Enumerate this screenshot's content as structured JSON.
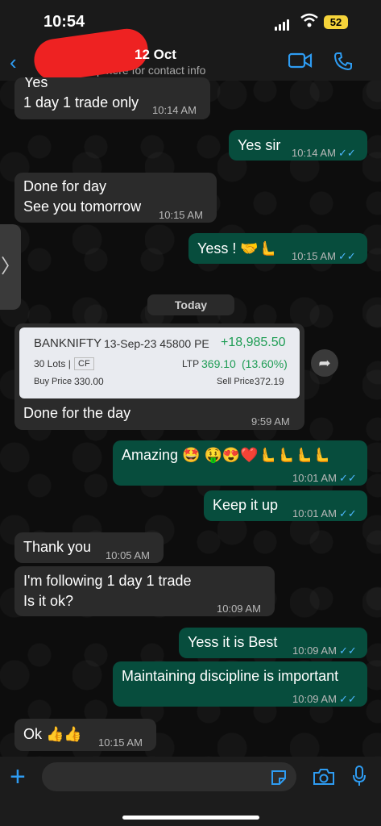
{
  "status_bar": {
    "time": "10:54",
    "battery": "52"
  },
  "header": {
    "date": "12 Oct",
    "subtitle": "p here for contact info"
  },
  "date_pill": "Today",
  "messages": [
    {
      "text": "Yes",
      "time": ""
    },
    {
      "text": "1 day 1 trade only",
      "time": "10:14 AM"
    },
    {
      "text": "Yes sir",
      "time": "10:14 AM"
    },
    {
      "text": "Done for day",
      "text2": "See you tomorrow",
      "time": "10:15 AM"
    },
    {
      "text": "Yess ! 🤝🫷",
      "time": "10:15 AM"
    },
    {
      "text": "Done for the day",
      "time": "9:59 AM"
    },
    {
      "text": "Amazing 🤩 🤑😍❤️🫷🫷🫷🫷",
      "time": "10:01 AM"
    },
    {
      "text": "Keep it up",
      "time": "10:01 AM"
    },
    {
      "text": "Thank you",
      "time": "10:05 AM"
    },
    {
      "text": "I'm following 1 day 1 trade",
      "text2": "Is it ok?",
      "time": "10:09 AM"
    },
    {
      "text": "Yess it is Best",
      "time": "10:09 AM"
    },
    {
      "text": "Maintaining discipline is important",
      "time": "10:09 AM"
    },
    {
      "text": "Ok 👍👍",
      "time": "10:15 AM"
    }
  ],
  "trade_card": {
    "symbol": "BANKNIFTY",
    "contract": "13-Sep-23 45800 PE",
    "pnl": "+18,985.50",
    "lots": "30 Lots |",
    "type": "CF",
    "ltp_label": "LTP",
    "ltp": "369.10",
    "ltp_change": "(13.60%)",
    "buy_label": "Buy Price",
    "buy_price": "330.00",
    "sell_label": "Sell Price",
    "sell_price": "372.19",
    "pnl_color": "#1f9d55"
  },
  "ticks": "✓✓",
  "icons": {
    "back": "‹",
    "forward": "➦",
    "plus": "+",
    "side": "〉"
  },
  "colors": {
    "outgoing": "#074d3d",
    "incoming": "#2b2b2b",
    "accent": "#2e9cf2",
    "battery": "#f5d33a"
  }
}
